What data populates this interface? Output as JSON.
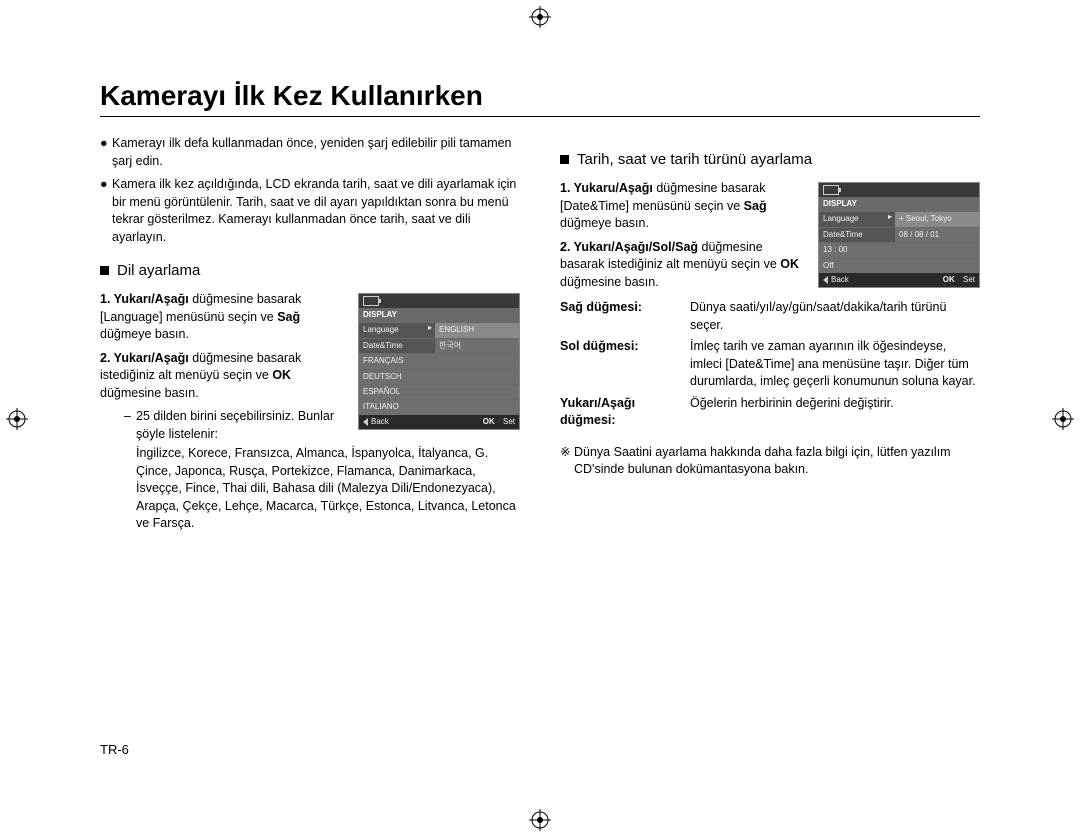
{
  "page": {
    "title": "Kamerayı İlk Kez Kullanırken",
    "pagenum": "TR-6"
  },
  "left": {
    "bullets": [
      "Kamerayı ilk defa kullanmadan önce, yeniden şarj edilebilir pili tamamen şarj edin.",
      "Kamera ilk kez açıldığında, LCD ekranda tarih, saat ve dili ayarlamak için bir menü görüntülenir. Tarih, saat ve dil ayarı yapıldıktan sonra bu menü tekrar gösterilmez. Kamerayı kullanmadan önce tarih, saat ve dili ayarlayın."
    ],
    "subhead": "Dil ayarlama",
    "steps": {
      "s1_label": "1. Yukarı/Aşağı",
      "s1_text": " düğmesine basarak [Language] menüsünü seçin ve ",
      "s1_bold2": "Sağ",
      "s1_tail": " düğmeye basın.",
      "s2_label": "2. Yukarı/Aşağı",
      "s2_text": " düğmesine basarak istediğiniz alt menüyü seçin ve ",
      "s2_bold2": "OK",
      "s2_tail": " düğmesine basın."
    },
    "sub_note_lead": "25 dilden birini seçebilirsiniz. Bunlar şöyle listelenir:",
    "languages": "İngilizce, Korece, Fransızca, Almanca, İspanyolca, İtalyanca, G. Çince, Japonca, Rusça, Portekizce, Flamanca, Danimarkaca, İsveççe, Fince, Thai dili, Bahasa dili (Malezya Dili/Endonezyaca), Arapça, Çekçe, Lehçe, Macarca, Türkçe, Estonca, Litvanca, Letonca ve Farsça.",
    "screen": {
      "tab": "DISPLAY",
      "rows": [
        {
          "k": "Language",
          "v": "ENGLISH",
          "sel": true
        },
        {
          "k": "Date&Time",
          "v": "한국어"
        }
      ],
      "list": [
        "FRANÇAIS",
        "DEUTSCH",
        "ESPAÑOL",
        "ITALIANO"
      ],
      "footer_back": "Back",
      "footer_ok": "OK",
      "footer_set": "Set"
    }
  },
  "right": {
    "subhead": "Tarih, saat ve tarih türünü ayarlama",
    "steps": {
      "s1_label": "1. Yukaru/Aşağı",
      "s1_text": " düğmesine basarak [Date&Time] menüsünü seçin ve ",
      "s1_bold2": "Sağ",
      "s1_tail": " düğmeye basın.",
      "s2_label": "2. Yukarı/Aşağı/Sol/Sağ",
      "s2_text": " düğmesine basarak istediğiniz alt menüyü seçin ve ",
      "s2_bold2": "OK",
      "s2_tail": " düğmesine basın."
    },
    "defs": [
      {
        "k": "Sağ düğmesi:",
        "v": "Dünya saati/yıl/ay/gün/saat/dakika/tarih türünü seçer.",
        "bold": true
      },
      {
        "k": "Sol düğmesi:",
        "v": "İmleç tarih ve zaman ayarının ilk öğesindeyse, imleci [Date&Time] ana menüsüne taşır. Diğer tüm durumlarda, imleç geçerli konumunun soluna kayar.",
        "bold": true
      },
      {
        "k": "Yukarı/Aşağı düğmesi:",
        "v": "Öğelerin herbirinin değerini değiştirir.",
        "bold": true
      }
    ],
    "note": "Dünya Saatini ayarlama hakkında daha fazla bilgi için, lütfen yazılım CD'sinde bulunan dokümantasyona bakın.",
    "screen": {
      "tab": "DISPLAY",
      "rows": [
        {
          "k": "Language",
          "v": "+ Seoul, Tokyo",
          "sel": true
        },
        {
          "k": "Date&Time",
          "v": "08 / 08 / 01"
        }
      ],
      "list": [
        "13 : 00",
        "Off"
      ],
      "footer_back": "Back",
      "footer_ok": "OK",
      "footer_set": "Set"
    }
  }
}
